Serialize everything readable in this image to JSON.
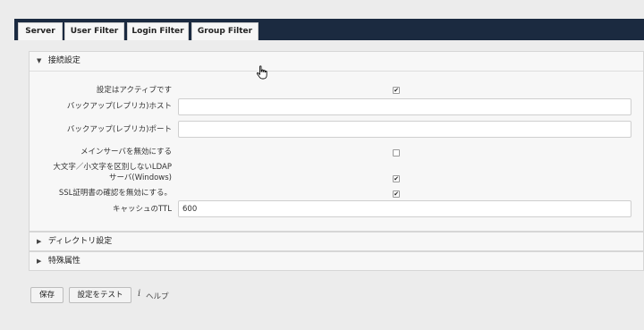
{
  "tabs": [
    "Server",
    "User Filter",
    "Login Filter",
    "Group Filter"
  ],
  "connection_section": {
    "title": "接続設定",
    "fields": {
      "active": {
        "label": "設定はアクティブです",
        "checked": true
      },
      "backup_host": {
        "label": "バックアップ(レプリカ)ホスト",
        "value": ""
      },
      "backup_port": {
        "label": "バックアップ(レプリカ)ポート",
        "value": ""
      },
      "disable_main_server": {
        "label": "メインサーバを無効にする",
        "checked": false
      },
      "case_insensitive": {
        "label_line1": "大文字／小文字を区別しないLDAP",
        "label_line2": "サーバ(Windows)",
        "checked": true
      },
      "disable_ssl_validation": {
        "label": "SSL証明書の確認を無効にする。",
        "checked": true
      },
      "cache_ttl": {
        "label": "キャッシュのTTL",
        "value": "600"
      }
    }
  },
  "directory_section": {
    "title": "ディレクトリ設定"
  },
  "special_section": {
    "title": "特殊属性"
  },
  "actions": {
    "save": "保存",
    "test": "設定をテスト",
    "help_icon_glyph": "i",
    "help": "ヘルプ"
  },
  "icons": {
    "expanded": "▼",
    "collapsed": "▶",
    "check": "✔"
  }
}
